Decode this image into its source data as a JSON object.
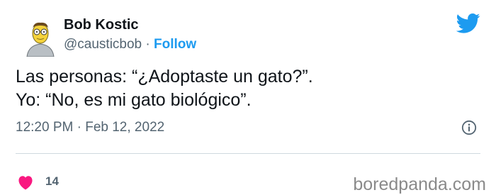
{
  "tweet": {
    "author_name": "Bob Kostic",
    "handle": "@causticbob",
    "separator": " · ",
    "follow_label": "Follow",
    "text_line1": "Las personas: “¿Adoptaste un gato?”.",
    "text_line2": "Yo: “No, es mi gato biológico”.",
    "time": "12:20 PM",
    "meta_separator": " · ",
    "date": "Feb 12, 2022",
    "likes": "14"
  },
  "watermark": "boredpanda.com",
  "colors": {
    "accent": "#1d9bf0",
    "heart": "#f91880",
    "secondary_text": "#536471"
  },
  "icons": [
    "avatar",
    "twitter-bird-icon",
    "info-icon",
    "heart-icon"
  ]
}
